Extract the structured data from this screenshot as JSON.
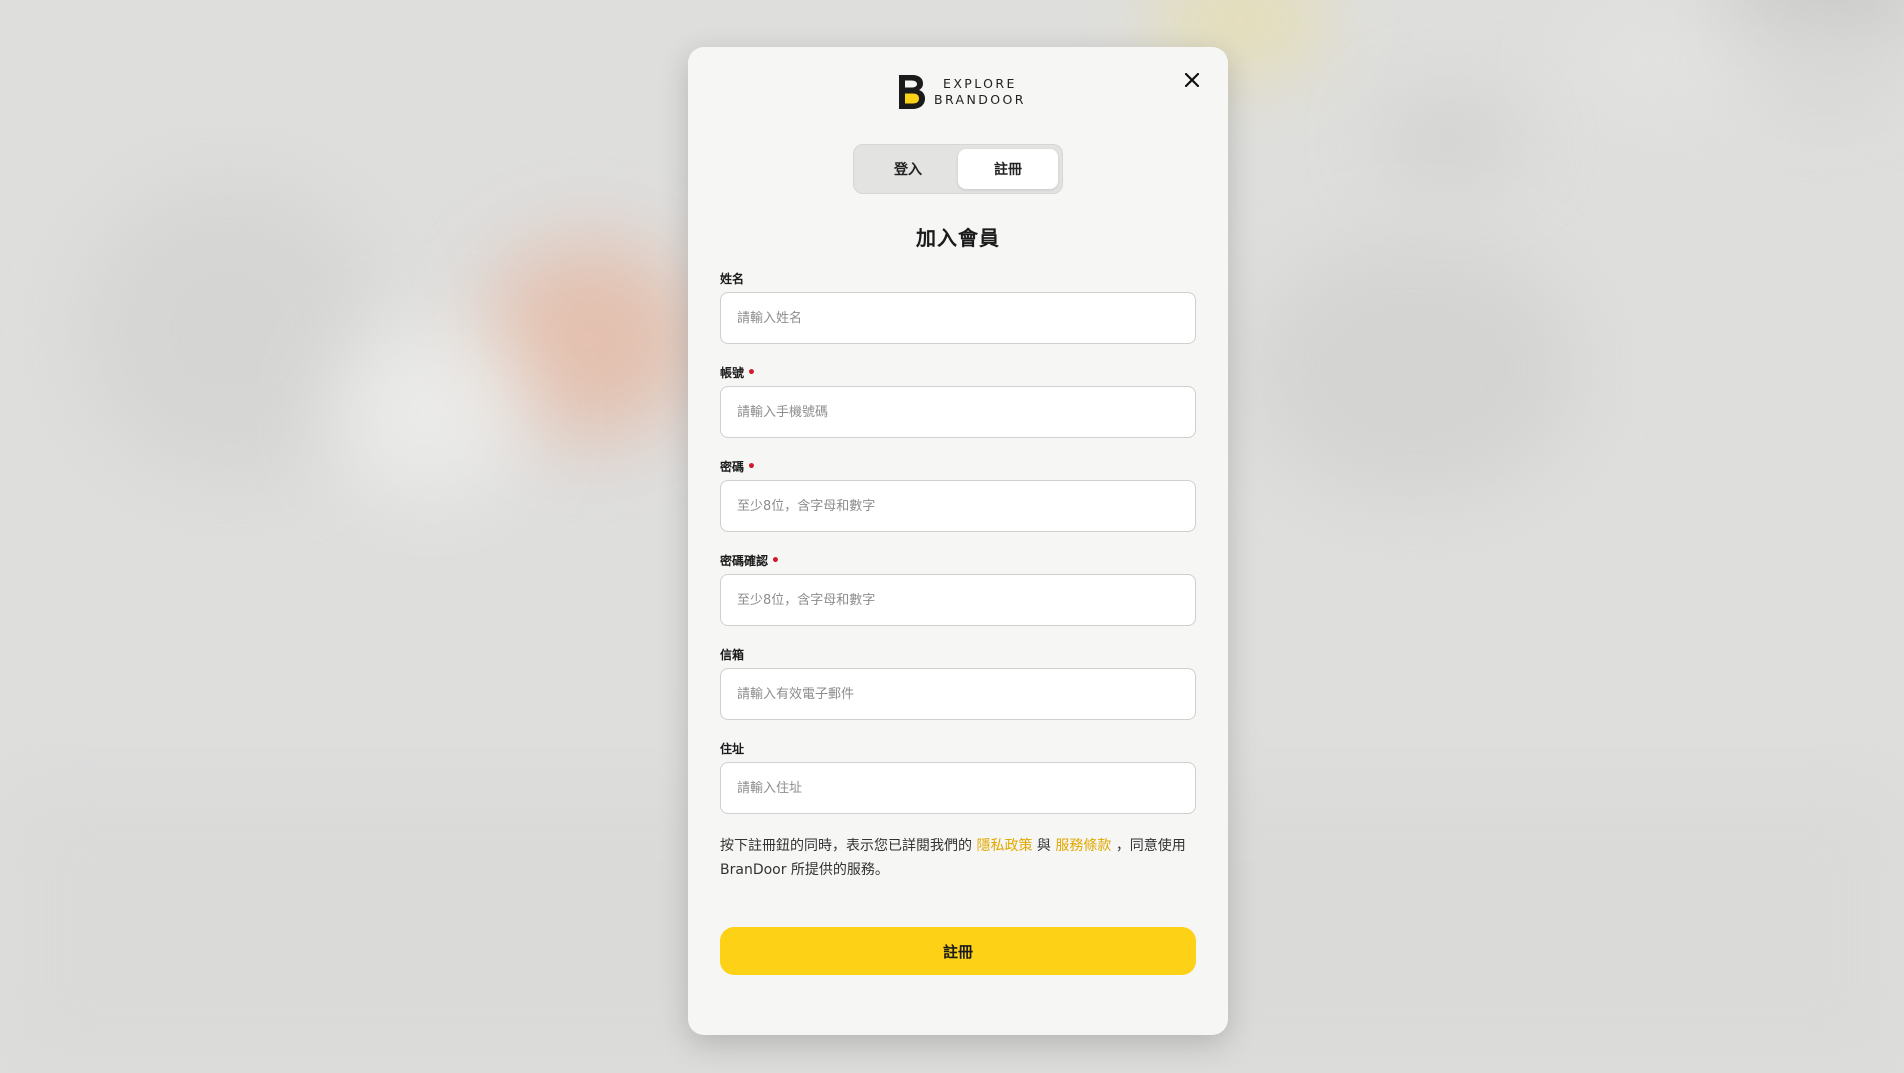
{
  "brand": {
    "line1": "EXPLORE",
    "line2": "BRANDOOR",
    "logo_color": "#fcd116"
  },
  "tabs": [
    {
      "label": "登入",
      "active": false
    },
    {
      "label": "註冊",
      "active": true
    }
  ],
  "title": "加入會員",
  "fields": {
    "name": {
      "label": "姓名",
      "placeholder": "請輸入姓名",
      "value": "",
      "required": false
    },
    "account": {
      "label": "帳號",
      "placeholder": "請輸入手機號碼",
      "value": "",
      "required": true
    },
    "password": {
      "label": "密碼",
      "placeholder": "至少8位，含字母和數字",
      "value": "",
      "required": true
    },
    "password_confirm": {
      "label": "密碼確認",
      "placeholder": "至少8位，含字母和數字",
      "value": "",
      "required": true
    },
    "email": {
      "label": "信箱",
      "placeholder": "請輸入有效電子郵件",
      "value": "",
      "required": false
    },
    "address": {
      "label": "住址",
      "placeholder": "請輸入住址",
      "value": "",
      "required": false
    }
  },
  "terms": {
    "prefix": "按下註冊鈕的同時，表示您已詳閱我們的",
    "privacy_link": "隱私政策",
    "conjunction": "與",
    "service_link": "服務條款",
    "suffix": "，同意使用 BranDoor 所提供的服務。"
  },
  "submit_label": "註冊",
  "required_mark": "•",
  "colors": {
    "accent": "#fcd116",
    "link": "#e0a800",
    "required": "#d11a2a"
  },
  "icons": {
    "close": "close-icon"
  }
}
